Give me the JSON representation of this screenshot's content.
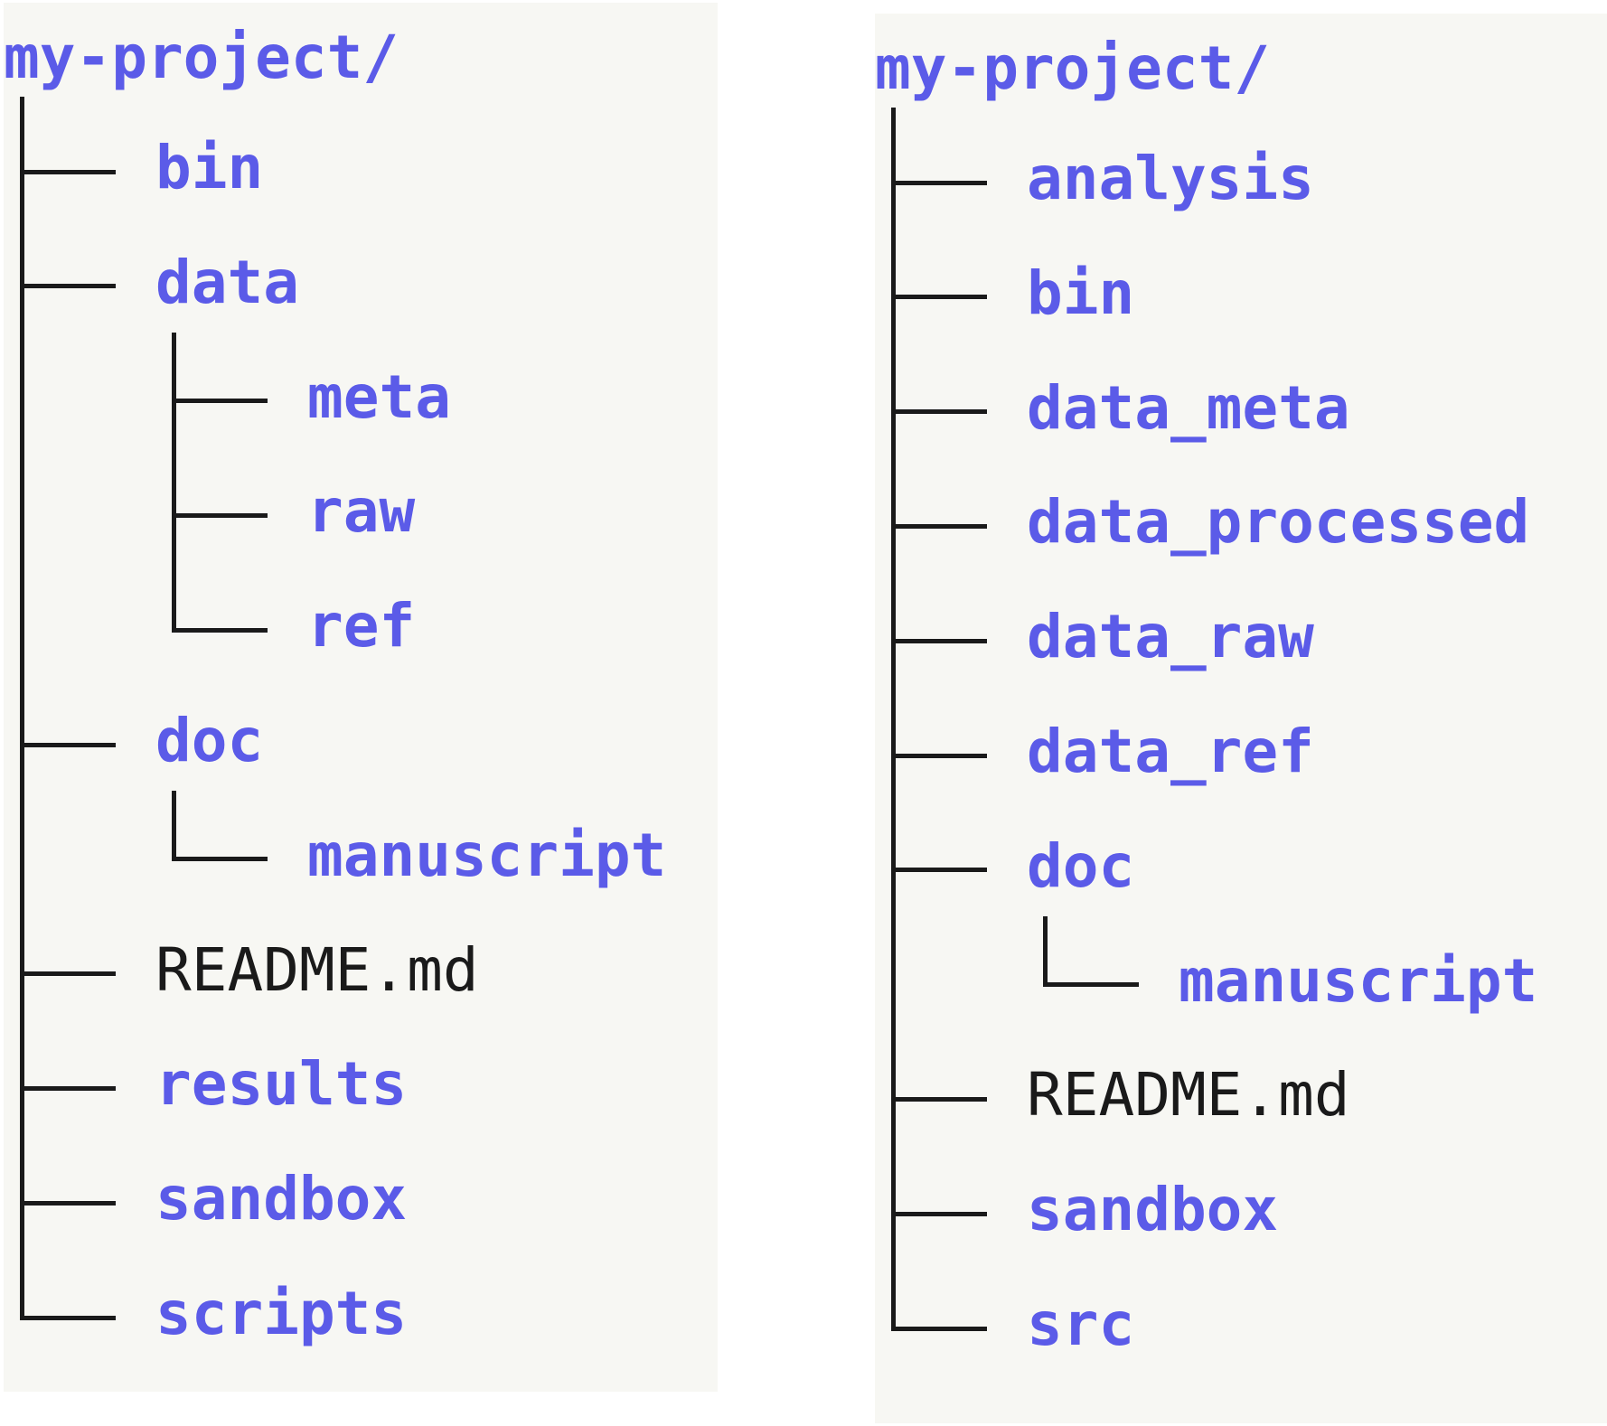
{
  "colors": {
    "directory": "#5b5be8",
    "file": "#1a1a1a",
    "connector": "#1a1a1a",
    "panel_background": "#f7f7f3"
  },
  "trees": [
    {
      "root": "my-project/",
      "items": [
        {
          "label": "bin",
          "type": "dir",
          "depth": 1
        },
        {
          "label": "data",
          "type": "dir",
          "depth": 1
        },
        {
          "label": "meta",
          "type": "dir",
          "depth": 2
        },
        {
          "label": "raw",
          "type": "dir",
          "depth": 2
        },
        {
          "label": "ref",
          "type": "dir",
          "depth": 2
        },
        {
          "label": "doc",
          "type": "dir",
          "depth": 1
        },
        {
          "label": "manuscript",
          "type": "dir",
          "depth": 2
        },
        {
          "label": "README.md",
          "type": "file",
          "depth": 1
        },
        {
          "label": "results",
          "type": "dir",
          "depth": 1
        },
        {
          "label": "sandbox",
          "type": "dir",
          "depth": 1
        },
        {
          "label": "scripts",
          "type": "dir",
          "depth": 1
        }
      ]
    },
    {
      "root": "my-project/",
      "items": [
        {
          "label": "analysis",
          "type": "dir",
          "depth": 1
        },
        {
          "label": "bin",
          "type": "dir",
          "depth": 1
        },
        {
          "label": "data_meta",
          "type": "dir",
          "depth": 1
        },
        {
          "label": "data_processed",
          "type": "dir",
          "depth": 1
        },
        {
          "label": "data_raw",
          "type": "dir",
          "depth": 1
        },
        {
          "label": "data_ref",
          "type": "dir",
          "depth": 1
        },
        {
          "label": "doc",
          "type": "dir",
          "depth": 1
        },
        {
          "label": "manuscript",
          "type": "dir",
          "depth": 2
        },
        {
          "label": "README.md",
          "type": "file",
          "depth": 1
        },
        {
          "label": "sandbox",
          "type": "dir",
          "depth": 1
        },
        {
          "label": "src",
          "type": "dir",
          "depth": 1
        }
      ]
    }
  ]
}
